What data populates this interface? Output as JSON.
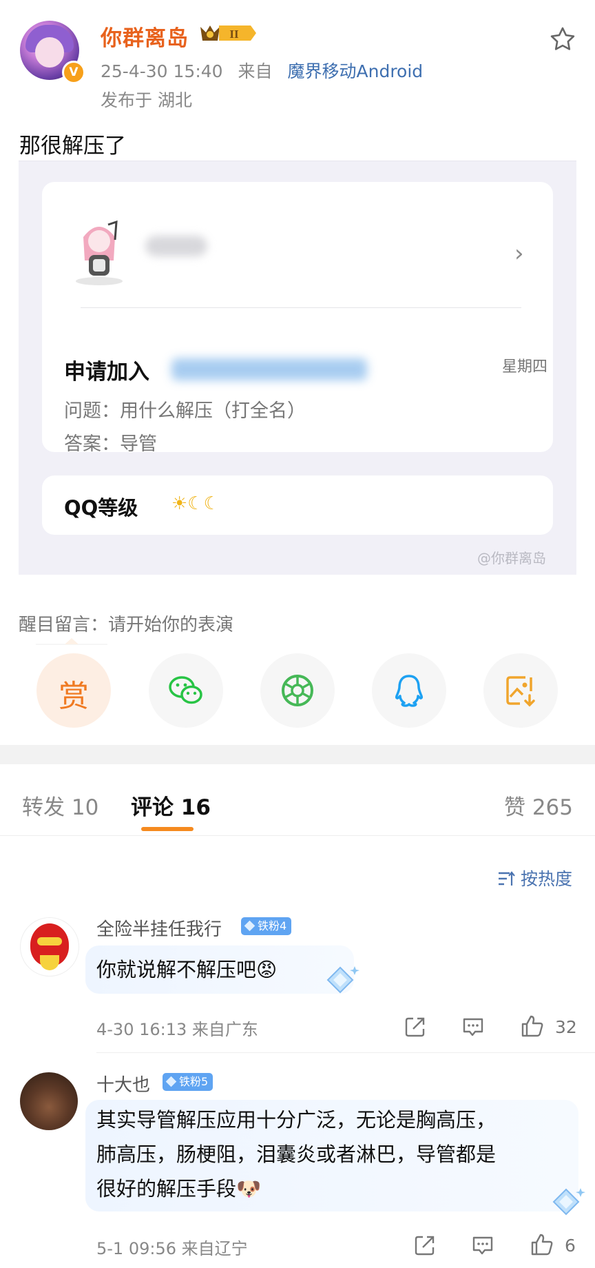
{
  "post": {
    "author": "你群离岛",
    "level_badge": "II",
    "timestamp": "25-4-30 15:40",
    "from_label": "来自",
    "source": "魔界移动Android",
    "location": "发布于 湖北",
    "text": "那很解压了"
  },
  "screenshot": {
    "apply_label": "申请加入",
    "weekday": "星期四",
    "question": "问题：用什么解压（打全名）",
    "answer": "答案：导管",
    "qq_level_label": "QQ等级",
    "qq_level_icons": "☀☾☾",
    "watermark": "@你群离岛"
  },
  "notice": "醒目留言：请开始你的表演",
  "share": {
    "reward_label": "赏"
  },
  "tabs": {
    "reposts": "转发 10",
    "comments": "评论 16",
    "likes": "赞 265"
  },
  "sort_label": "按热度",
  "comments": [
    {
      "name": "全险半挂任我行",
      "badge": "铁粉4",
      "text": "你就说解不解压吧😡",
      "time_loc": "4-30 16:13 来自广东",
      "likes": "32"
    },
    {
      "name": "十大也",
      "badge": "铁粉5",
      "text_lines": [
        "其实导管解压应用十分广泛，无论是胸高压，",
        "肺高压，肠梗阻，泪囊炎或者淋巴，导管都是",
        "很好的解压手段🐶"
      ],
      "time_loc": "5-1 09:56 来自辽宁",
      "likes": "6"
    }
  ],
  "icons": {
    "star": "star-icon",
    "wechat": "wechat-icon",
    "moments": "moments-icon",
    "qq": "qq-icon",
    "save": "save-image-icon",
    "share": "share-icon",
    "comment": "comment-icon",
    "like": "thumb-up-icon"
  },
  "colors": {
    "username": "#e8621d",
    "link": "#3e6fb0",
    "accent": "#f58a1f",
    "reward": "#f07a22",
    "wechat": "#28c445",
    "moments": "#46b857",
    "qq": "#1da1f2",
    "save": "#f0a52d"
  }
}
